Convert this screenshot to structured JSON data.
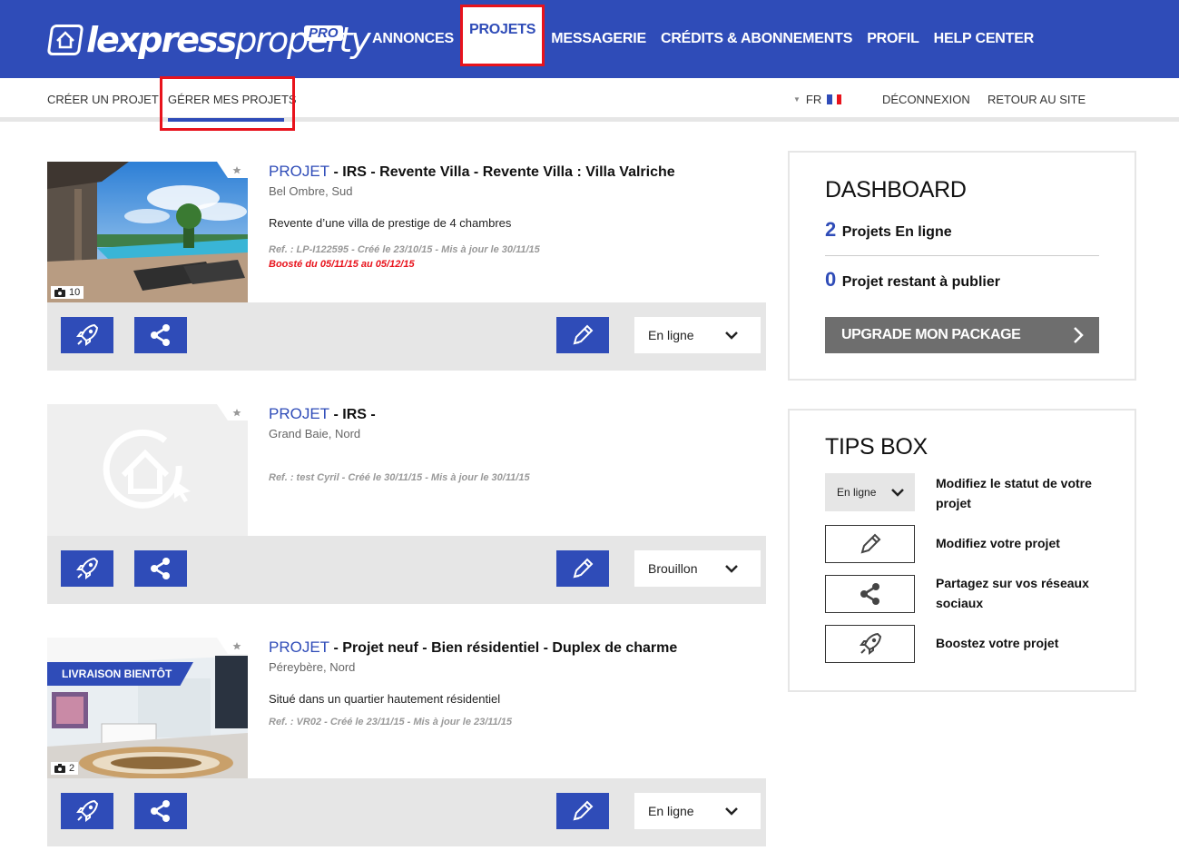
{
  "brand": {
    "name_bold": "lexpress",
    "name_light": "property",
    "badge": "PRO"
  },
  "nav": {
    "items": [
      "ANNONCES",
      "PROJETS",
      "MESSAGERIE",
      "CRÉDITS & ABONNEMENTS",
      "PROFIL",
      "HELP CENTER"
    ],
    "active": "PROJETS"
  },
  "subnav": {
    "create": "CRÉER UN PROJET",
    "manage": "GÉRER MES PROJETS",
    "lang": "FR",
    "logout": "DÉCONNEXION",
    "back": "RETOUR AU SITE"
  },
  "listings": [
    {
      "keyword": "PROJET",
      "title": " - IRS - Revente Villa - Revente Villa : Villa Valriche",
      "location": "Bel Ombre, Sud",
      "description": "Revente d’une villa de prestige de 4 chambres",
      "ref": "Ref. : LP-I122595 - Créé le 23/10/15 - Mis à jour le 30/11/15",
      "boost": "Boosté du 05/11/15 au 05/12/15",
      "photos": "10",
      "status": "En ligne"
    },
    {
      "keyword": "PROJET",
      "title": " - IRS -",
      "location": "Grand Baie, Nord",
      "description": "",
      "ref": "Ref. : test Cyril - Créé le 30/11/15 - Mis à jour le 30/11/15",
      "status": "Brouillon"
    },
    {
      "keyword": "PROJET",
      "title": " - Projet neuf - Bien résidentiel - Duplex de charme",
      "location": "Péreybère, Nord",
      "description": "Situé dans un quartier hautement résidentiel",
      "ref": "Ref. : VR02 - Créé le 23/11/15 - Mis à jour le 23/11/15",
      "ribbon": "LIVRAISON BIENTÔT",
      "photos": "2",
      "status": "En ligne"
    }
  ],
  "dashboard": {
    "title": "DASHBOARD",
    "online_count": "2",
    "online_label": "Projets En ligne",
    "remaining_count": "0",
    "remaining_label": "Projet restant à publier",
    "upgrade_label": "UPGRADE MON PACKAGE"
  },
  "tips": {
    "title": "TIPS BOX",
    "status_sample": "En ligne",
    "items": [
      "Modifiez le statut de votre projet",
      "Modifiez votre projet",
      "Partagez sur vos réseaux sociaux",
      "Boostez votre projet"
    ]
  },
  "colors": {
    "brand_blue": "#2f4cb8",
    "highlight_red": "#e8131c",
    "action_bar": "#e6e6e6",
    "upgrade_grey": "#6e6e6e"
  }
}
